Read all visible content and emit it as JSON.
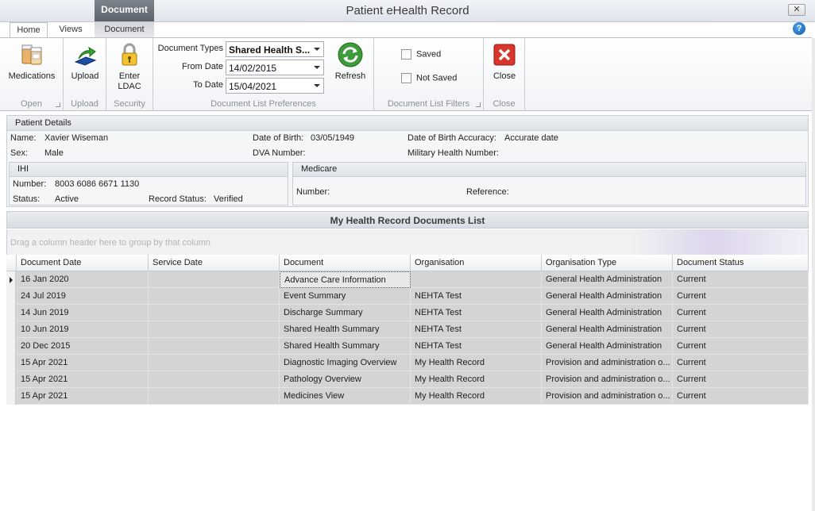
{
  "window": {
    "title": "Patient eHealth Record",
    "close_glyph": "✕",
    "help_glyph": "?"
  },
  "ribbon": {
    "contextual_header": "Document",
    "tabs": [
      {
        "label": "Home",
        "active": true
      },
      {
        "label": "Views",
        "active": false
      },
      {
        "label": "Document",
        "active": false
      }
    ],
    "groups": {
      "open": {
        "label": "Open",
        "buttons": [
          {
            "label": "Medications",
            "icon": "medications-icon"
          }
        ]
      },
      "upload": {
        "label": "Upload",
        "buttons": [
          {
            "label": "Upload",
            "icon": "upload-icon"
          }
        ]
      },
      "security": {
        "label": "Security",
        "buttons": [
          {
            "label_line1": "Enter",
            "label_line2": "LDAC",
            "icon": "padlock-icon"
          }
        ]
      },
      "preferences": {
        "label": "Document List Preferences",
        "document_types_label": "Document Types",
        "document_types_value": "Shared Health S...",
        "from_date_label": "From Date",
        "from_date_value": "14/02/2015",
        "to_date_label": "To Date",
        "to_date_value": "15/04/2021",
        "refresh_label": "Refresh"
      },
      "filters": {
        "label": "Document List Filters",
        "saved_label": "Saved",
        "saved_checked": false,
        "not_saved_label": "Not Saved",
        "not_saved_checked": false
      },
      "close": {
        "label": "Close",
        "button_label": "Close"
      }
    }
  },
  "patient": {
    "header": "Patient Details",
    "name_label": "Name:",
    "name_value": "Xavier Wiseman",
    "sex_label": "Sex:",
    "sex_value": "Male",
    "dob_label": "Date of Birth:",
    "dob_value": "03/05/1949",
    "dva_label": "DVA Number:",
    "dob_accuracy_label": "Date of Birth Accuracy:",
    "dob_accuracy_value": "Accurate date",
    "military_label": "Military Health Number:",
    "ihi": {
      "header": "IHI",
      "number_label": "Number:",
      "number_value": "8003 6086 6671 1130",
      "status_label": "Status:",
      "status_value": "Active",
      "record_status_label": "Record Status:",
      "record_status_value": "Verified"
    },
    "medicare": {
      "header": "Medicare",
      "number_label": "Number:",
      "reference_label": "Reference:"
    }
  },
  "documents": {
    "title": "My Health Record Documents List",
    "group_hint": "Drag a column header here to group by that column",
    "columns": [
      "Document Date",
      "Service Date",
      "Document",
      "Organisation",
      "Organisation Type",
      "Document Status"
    ],
    "rows": [
      [
        "16 Jan 2020",
        "",
        "Advance Care Information",
        "",
        "General Health Administration",
        "Current"
      ],
      [
        "24 Jul 2019",
        "",
        "Event Summary",
        "NEHTA Test",
        "General Health Administration",
        "Current"
      ],
      [
        "14 Jun 2019",
        "",
        "Discharge Summary",
        "NEHTA Test",
        "General Health Administration",
        "Current"
      ],
      [
        "10 Jun 2019",
        "",
        "Shared Health Summary",
        "NEHTA Test",
        "General Health Administration",
        "Current"
      ],
      [
        "20 Dec 2015",
        "",
        "Shared Health Summary",
        "NEHTA Test",
        "General Health Administration",
        "Current"
      ],
      [
        "15 Apr 2021",
        "",
        "Diagnostic Imaging Overview",
        "My Health Record",
        "Provision and administration o...",
        "Current"
      ],
      [
        "15 Apr 2021",
        "",
        "Pathology Overview",
        "My Health Record",
        "Provision and administration o...",
        "Current"
      ],
      [
        "15 Apr 2021",
        "",
        "Medicines View",
        "My Health Record",
        "Provision and administration o...",
        "Current"
      ]
    ]
  }
}
